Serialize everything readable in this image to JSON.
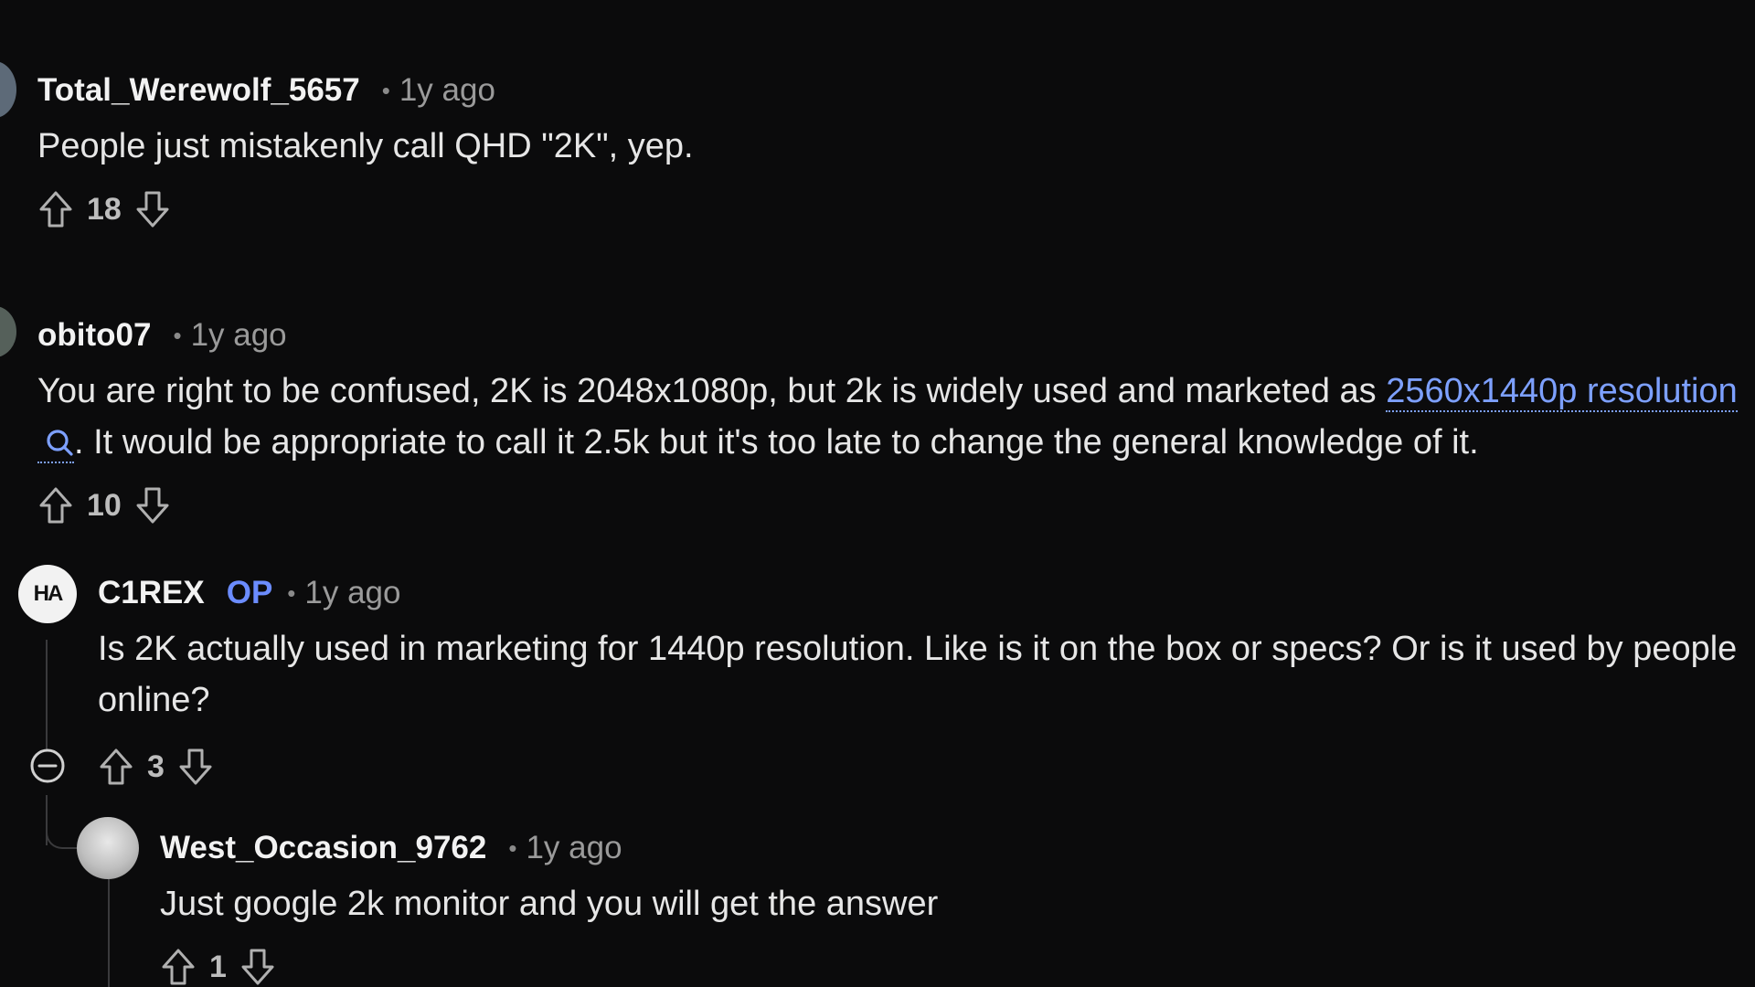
{
  "comments": [
    {
      "author": "Total_Werewolf_5657",
      "separator": "•",
      "time": "1y ago",
      "body": "People just mistakenly call QHD \"2K\", yep.",
      "score": "18"
    },
    {
      "author": "obito07",
      "separator": "•",
      "time": "1y ago",
      "body_before_link": "You are right to be confused, 2K is 2048x1080p, but 2k is widely used and marketed as ",
      "link_text": "2560x1440p resolution",
      "link_icon": "search-icon",
      "body_after_link": ". It would be appropriate to call it 2.5k but it's too late to change the general knowledge of it.",
      "score": "10"
    },
    {
      "author": "C1REX",
      "op_badge": "OP",
      "avatar_text": "HA",
      "separator": "•",
      "time": "1y ago",
      "body": "Is 2K actually used in marketing for 1440p resolution. Like is it on the box or specs? Or is it used by people online?",
      "score": "3"
    },
    {
      "author": "West_Occasion_9762",
      "separator": "•",
      "time": "1y ago",
      "body": "Just google 2k monitor and you will get the answer",
      "score": "1"
    }
  ],
  "colors": {
    "background": "#0b0b0c",
    "link": "#7da0ff",
    "op_badge": "#6b8cff"
  },
  "icons": {
    "upvote": "arrow-up-outline-icon",
    "downvote": "arrow-down-outline-icon",
    "collapse": "minus-circle-icon"
  }
}
